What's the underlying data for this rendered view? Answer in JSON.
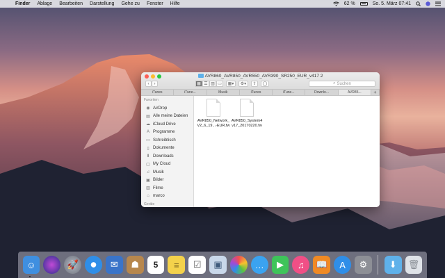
{
  "menubar": {
    "app_name": "Finder",
    "items": [
      "Ablage",
      "Bearbeiten",
      "Darstellung",
      "Gehe zu",
      "Fenster",
      "Hilfe"
    ],
    "battery_percent": "62 %",
    "datetime": "So. 5. März  07:41"
  },
  "window": {
    "title": "AVR860_AVR850_AVR550_AVR390_SR250_EUR_v417 2",
    "search_placeholder": "Suchen",
    "view_buttons": [
      "icon-view",
      "list-view",
      "column-view",
      "cover-flow-view"
    ],
    "tabs": [
      "iTunes",
      "iTune...",
      "Musik",
      "iTunes",
      "iTune...",
      "Downlo...",
      "AVR85..."
    ],
    "active_tab_index": 6,
    "sidebar_section": "Favoriten",
    "sidebar_section_2": "Geräte",
    "sidebar_items": [
      {
        "label": "AirDrop",
        "icon": "airdrop-icon"
      },
      {
        "label": "Alle meine Dateien",
        "icon": "all-files-icon"
      },
      {
        "label": "iCloud Drive",
        "icon": "cloud-icon"
      },
      {
        "label": "Programme",
        "icon": "applications-icon"
      },
      {
        "label": "Schreibtisch",
        "icon": "desktop-icon"
      },
      {
        "label": "Dokumente",
        "icon": "documents-icon"
      },
      {
        "label": "Downloads",
        "icon": "downloads-icon"
      },
      {
        "label": "My Cloud",
        "icon": "cloud-drive-icon"
      },
      {
        "label": "Musik",
        "icon": "music-icon"
      },
      {
        "label": "Bilder",
        "icon": "pictures-icon"
      },
      {
        "label": "Filme",
        "icon": "movies-icon"
      },
      {
        "label": "marco",
        "icon": "home-icon"
      }
    ],
    "files": [
      {
        "line1": "AVR850_Network_",
        "line2": "V2_6_19...-EUR.fw"
      },
      {
        "line1": "AVR850_System4",
        "line2": "v17_20170220.fw"
      }
    ]
  },
  "dock": {
    "icons": [
      "finder-icon",
      "siri-icon",
      "launchpad-icon",
      "safari-icon",
      "mail-stamp-icon",
      "contacts-icon",
      "calendar-icon",
      "notes-icon",
      "reminders-icon",
      "preview-icon",
      "photos-icon",
      "messages-icon",
      "facetime-icon",
      "itunes-icon",
      "ibooks-icon",
      "app-store-icon",
      "system-preferences-icon",
      "downloads-folder-icon",
      "trash-icon"
    ],
    "calendar_day": "5",
    "colors": {
      "finder": "#3f8fe0",
      "siri": "#6a4bd1",
      "launchpad": "#8a8f9a",
      "safari": "#2f8ee8",
      "mail": "#3a74c9",
      "contacts": "#b7874d",
      "calendar": "#ffffff",
      "notes": "#f4d24b",
      "reminders": "#ffffff",
      "preview": "#c9d8ea",
      "photos": "#ffffff",
      "messages": "#3aa3f0",
      "facetime": "#3ec45a",
      "itunes": "#f04f86",
      "ibooks": "#f08a24",
      "appstore": "#2f8ee8",
      "sysprefs": "#8d8f96",
      "folder": "#5fb1ea",
      "trash": "#dfe3e8"
    }
  }
}
